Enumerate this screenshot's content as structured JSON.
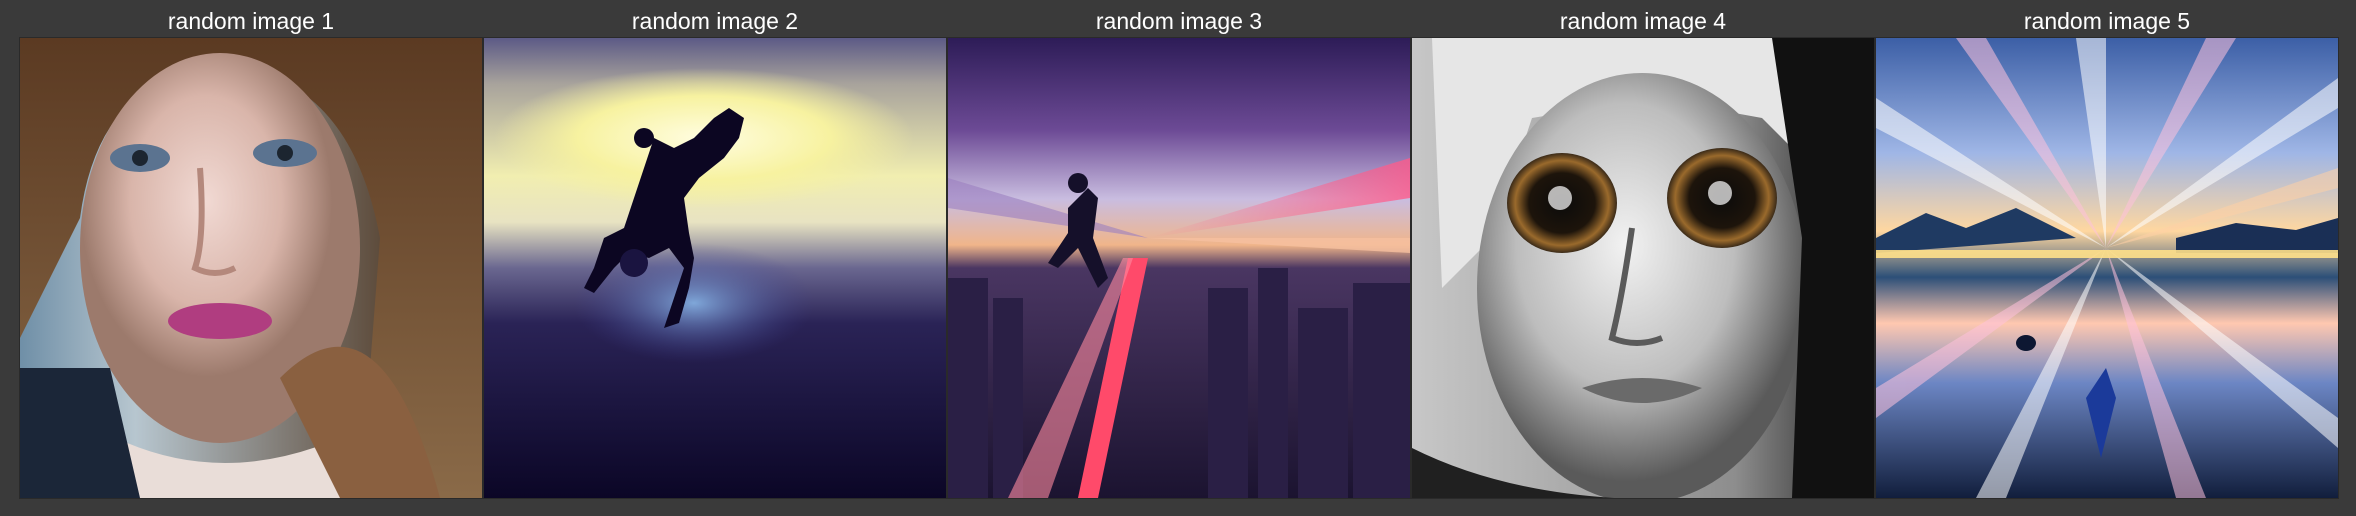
{
  "gallery": {
    "images": [
      {
        "title": "random image 1"
      },
      {
        "title": "random image 2"
      },
      {
        "title": "random image 3"
      },
      {
        "title": "random image 4"
      },
      {
        "title": "random image 5"
      }
    ]
  }
}
